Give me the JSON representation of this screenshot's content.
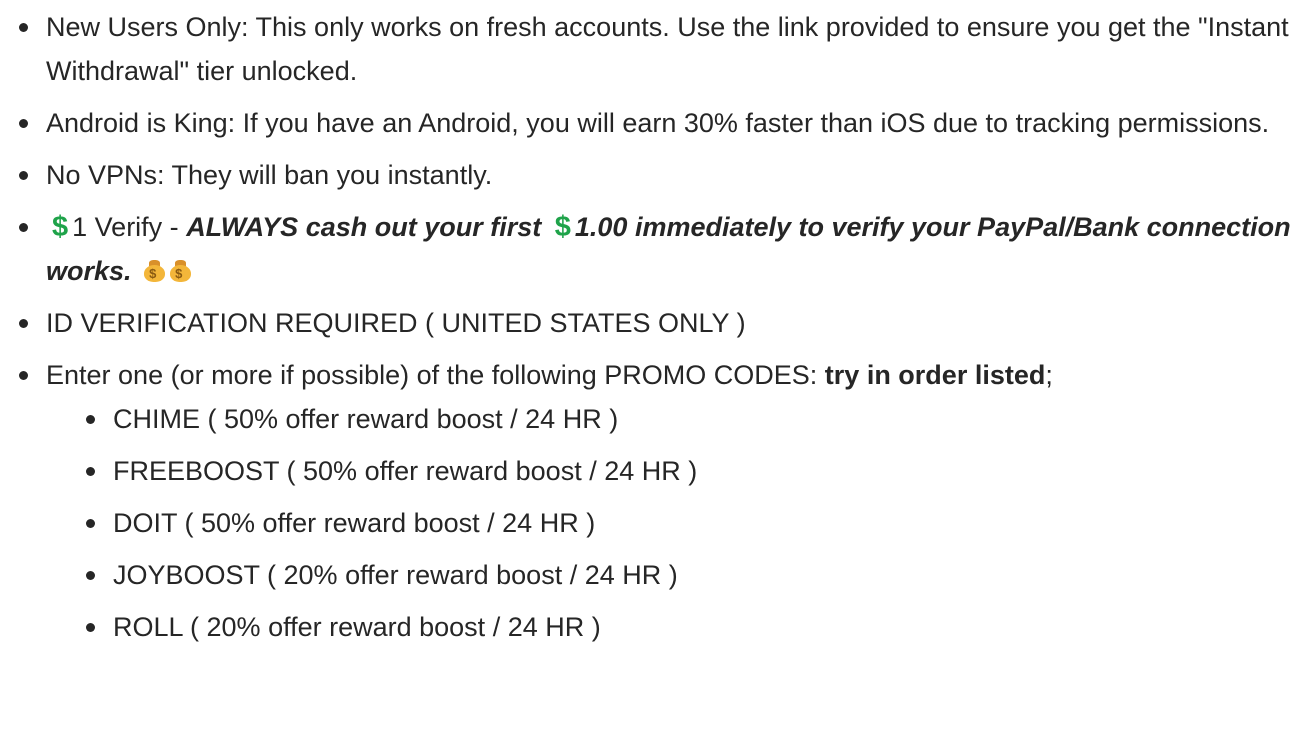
{
  "items": [
    {
      "text": "New Users Only: This only works on fresh accounts. Use the link provided to ensure you get the \"Instant Withdrawal\" tier unlocked."
    },
    {
      "text": "Android is King: If you have an Android, you will earn 30% faster than iOS due to tracking permissions."
    },
    {
      "text": "No VPNs: They will ban you instantly."
    },
    {
      "plain": "1 Verify - ",
      "emphasis_a": "ALWAYS cash out your first ",
      "emphasis_b": "1.00 immediately to verify your PayPal/Bank connection works.",
      "dollar_symbol": "$",
      "icons": [
        "dollar-icon",
        "money-bag-icon"
      ]
    },
    {
      "text": "ID VERIFICATION REQUIRED ( UNITED STATES ONLY )"
    },
    {
      "text_before": "Enter one (or more if possible) of the following PROMO CODES: ",
      "bold": "try in order listed",
      "text_after": ";",
      "sub_items": [
        "CHIME ( 50% offer reward boost / 24 HR )",
        "FREEBOOST ( 50% offer reward boost / 24 HR )",
        "DOIT ( 50% offer reward boost / 24 HR )",
        "JOYBOOST ( 20% offer reward boost / 24 HR )",
        "ROLL ( 20% offer reward boost / 24 HR )"
      ]
    }
  ],
  "colors": {
    "text": "#262626",
    "dollar": "#1fa34a",
    "money_bag": "#f3b63a"
  }
}
